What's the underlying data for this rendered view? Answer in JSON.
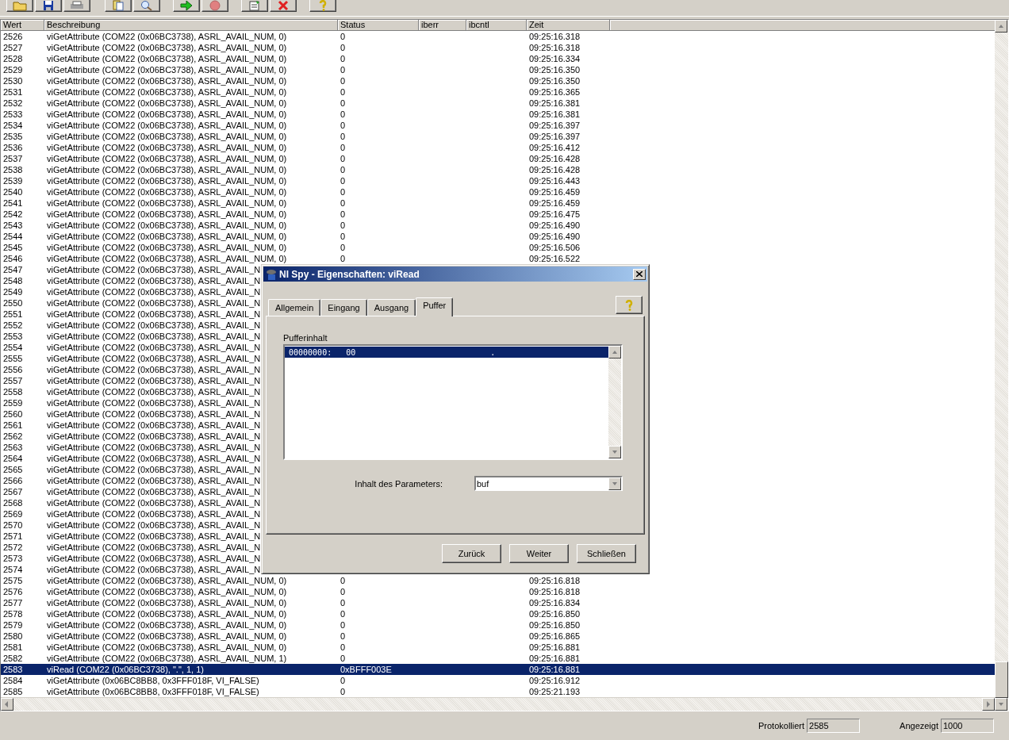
{
  "toolbar": {
    "buttons": [
      {
        "kind": "open"
      },
      {
        "kind": "save"
      },
      {
        "kind": "print"
      },
      {
        "kind": "copy"
      },
      {
        "kind": "find"
      },
      {
        "kind": "start"
      },
      {
        "kind": "stop"
      },
      {
        "kind": "properties"
      },
      {
        "kind": "clear"
      },
      {
        "kind": "help"
      }
    ]
  },
  "table": {
    "columns": [
      "Wert",
      "Beschreibung",
      "Status",
      "iberr",
      "ibcntl",
      "Zeit"
    ],
    "rows": [
      {
        "wert": "2526",
        "beschreibung": "viGetAttribute (COM22 (0x06BC3738), ASRL_AVAIL_NUM, 0)",
        "status": "0",
        "zeit": "09:25:16.318",
        "selected": false
      },
      {
        "wert": "2527",
        "beschreibung": "viGetAttribute (COM22 (0x06BC3738), ASRL_AVAIL_NUM, 0)",
        "status": "0",
        "zeit": "09:25:16.318",
        "selected": false
      },
      {
        "wert": "2528",
        "beschreibung": "viGetAttribute (COM22 (0x06BC3738), ASRL_AVAIL_NUM, 0)",
        "status": "0",
        "zeit": "09:25:16.334",
        "selected": false
      },
      {
        "wert": "2529",
        "beschreibung": "viGetAttribute (COM22 (0x06BC3738), ASRL_AVAIL_NUM, 0)",
        "status": "0",
        "zeit": "09:25:16.350",
        "selected": false
      },
      {
        "wert": "2530",
        "beschreibung": "viGetAttribute (COM22 (0x06BC3738), ASRL_AVAIL_NUM, 0)",
        "status": "0",
        "zeit": "09:25:16.350",
        "selected": false
      },
      {
        "wert": "2531",
        "beschreibung": "viGetAttribute (COM22 (0x06BC3738), ASRL_AVAIL_NUM, 0)",
        "status": "0",
        "zeit": "09:25:16.365",
        "selected": false
      },
      {
        "wert": "2532",
        "beschreibung": "viGetAttribute (COM22 (0x06BC3738), ASRL_AVAIL_NUM, 0)",
        "status": "0",
        "zeit": "09:25:16.381",
        "selected": false
      },
      {
        "wert": "2533",
        "beschreibung": "viGetAttribute (COM22 (0x06BC3738), ASRL_AVAIL_NUM, 0)",
        "status": "0",
        "zeit": "09:25:16.381",
        "selected": false
      },
      {
        "wert": "2534",
        "beschreibung": "viGetAttribute (COM22 (0x06BC3738), ASRL_AVAIL_NUM, 0)",
        "status": "0",
        "zeit": "09:25:16.397",
        "selected": false
      },
      {
        "wert": "2535",
        "beschreibung": "viGetAttribute (COM22 (0x06BC3738), ASRL_AVAIL_NUM, 0)",
        "status": "0",
        "zeit": "09:25:16.397",
        "selected": false
      },
      {
        "wert": "2536",
        "beschreibung": "viGetAttribute (COM22 (0x06BC3738), ASRL_AVAIL_NUM, 0)",
        "status": "0",
        "zeit": "09:25:16.412",
        "selected": false
      },
      {
        "wert": "2537",
        "beschreibung": "viGetAttribute (COM22 (0x06BC3738), ASRL_AVAIL_NUM, 0)",
        "status": "0",
        "zeit": "09:25:16.428",
        "selected": false
      },
      {
        "wert": "2538",
        "beschreibung": "viGetAttribute (COM22 (0x06BC3738), ASRL_AVAIL_NUM, 0)",
        "status": "0",
        "zeit": "09:25:16.428",
        "selected": false
      },
      {
        "wert": "2539",
        "beschreibung": "viGetAttribute (COM22 (0x06BC3738), ASRL_AVAIL_NUM, 0)",
        "status": "0",
        "zeit": "09:25:16.443",
        "selected": false
      },
      {
        "wert": "2540",
        "beschreibung": "viGetAttribute (COM22 (0x06BC3738), ASRL_AVAIL_NUM, 0)",
        "status": "0",
        "zeit": "09:25:16.459",
        "selected": false
      },
      {
        "wert": "2541",
        "beschreibung": "viGetAttribute (COM22 (0x06BC3738), ASRL_AVAIL_NUM, 0)",
        "status": "0",
        "zeit": "09:25:16.459",
        "selected": false
      },
      {
        "wert": "2542",
        "beschreibung": "viGetAttribute (COM22 (0x06BC3738), ASRL_AVAIL_NUM, 0)",
        "status": "0",
        "zeit": "09:25:16.475",
        "selected": false
      },
      {
        "wert": "2543",
        "beschreibung": "viGetAttribute (COM22 (0x06BC3738), ASRL_AVAIL_NUM, 0)",
        "status": "0",
        "zeit": "09:25:16.490",
        "selected": false
      },
      {
        "wert": "2544",
        "beschreibung": "viGetAttribute (COM22 (0x06BC3738), ASRL_AVAIL_NUM, 0)",
        "status": "0",
        "zeit": "09:25:16.490",
        "selected": false
      },
      {
        "wert": "2545",
        "beschreibung": "viGetAttribute (COM22 (0x06BC3738), ASRL_AVAIL_NUM, 0)",
        "status": "0",
        "zeit": "09:25:16.506",
        "selected": false
      },
      {
        "wert": "2546",
        "beschreibung": "viGetAttribute (COM22 (0x06BC3738), ASRL_AVAIL_NUM, 0)",
        "status": "0",
        "zeit": "09:25:16.522",
        "selected": false
      },
      {
        "wert": "2547",
        "beschreibung": "viGetAttribute (COM22 (0x06BC3738), ASRL_AVAIL_N",
        "selected": false
      },
      {
        "wert": "2548",
        "beschreibung": "viGetAttribute (COM22 (0x06BC3738), ASRL_AVAIL_N",
        "selected": false
      },
      {
        "wert": "2549",
        "beschreibung": "viGetAttribute (COM22 (0x06BC3738), ASRL_AVAIL_N",
        "selected": false
      },
      {
        "wert": "2550",
        "beschreibung": "viGetAttribute (COM22 (0x06BC3738), ASRL_AVAIL_N",
        "selected": false
      },
      {
        "wert": "2551",
        "beschreibung": "viGetAttribute (COM22 (0x06BC3738), ASRL_AVAIL_N",
        "selected": false
      },
      {
        "wert": "2552",
        "beschreibung": "viGetAttribute (COM22 (0x06BC3738), ASRL_AVAIL_N",
        "selected": false
      },
      {
        "wert": "2553",
        "beschreibung": "viGetAttribute (COM22 (0x06BC3738), ASRL_AVAIL_N",
        "selected": false
      },
      {
        "wert": "2554",
        "beschreibung": "viGetAttribute (COM22 (0x06BC3738), ASRL_AVAIL_N",
        "selected": false
      },
      {
        "wert": "2555",
        "beschreibung": "viGetAttribute (COM22 (0x06BC3738), ASRL_AVAIL_N",
        "selected": false
      },
      {
        "wert": "2556",
        "beschreibung": "viGetAttribute (COM22 (0x06BC3738), ASRL_AVAIL_N",
        "selected": false
      },
      {
        "wert": "2557",
        "beschreibung": "viGetAttribute (COM22 (0x06BC3738), ASRL_AVAIL_N",
        "selected": false
      },
      {
        "wert": "2558",
        "beschreibung": "viGetAttribute (COM22 (0x06BC3738), ASRL_AVAIL_N",
        "selected": false
      },
      {
        "wert": "2559",
        "beschreibung": "viGetAttribute (COM22 (0x06BC3738), ASRL_AVAIL_N",
        "selected": false
      },
      {
        "wert": "2560",
        "beschreibung": "viGetAttribute (COM22 (0x06BC3738), ASRL_AVAIL_N",
        "selected": false
      },
      {
        "wert": "2561",
        "beschreibung": "viGetAttribute (COM22 (0x06BC3738), ASRL_AVAIL_N",
        "selected": false
      },
      {
        "wert": "2562",
        "beschreibung": "viGetAttribute (COM22 (0x06BC3738), ASRL_AVAIL_N",
        "selected": false
      },
      {
        "wert": "2563",
        "beschreibung": "viGetAttribute (COM22 (0x06BC3738), ASRL_AVAIL_N",
        "selected": false
      },
      {
        "wert": "2564",
        "beschreibung": "viGetAttribute (COM22 (0x06BC3738), ASRL_AVAIL_N",
        "selected": false
      },
      {
        "wert": "2565",
        "beschreibung": "viGetAttribute (COM22 (0x06BC3738), ASRL_AVAIL_N",
        "selected": false
      },
      {
        "wert": "2566",
        "beschreibung": "viGetAttribute (COM22 (0x06BC3738), ASRL_AVAIL_N",
        "selected": false
      },
      {
        "wert": "2567",
        "beschreibung": "viGetAttribute (COM22 (0x06BC3738), ASRL_AVAIL_N",
        "selected": false
      },
      {
        "wert": "2568",
        "beschreibung": "viGetAttribute (COM22 (0x06BC3738), ASRL_AVAIL_N",
        "selected": false
      },
      {
        "wert": "2569",
        "beschreibung": "viGetAttribute (COM22 (0x06BC3738), ASRL_AVAIL_N",
        "selected": false
      },
      {
        "wert": "2570",
        "beschreibung": "viGetAttribute (COM22 (0x06BC3738), ASRL_AVAIL_N",
        "selected": false
      },
      {
        "wert": "2571",
        "beschreibung": "viGetAttribute (COM22 (0x06BC3738), ASRL_AVAIL_N",
        "selected": false
      },
      {
        "wert": "2572",
        "beschreibung": "viGetAttribute (COM22 (0x06BC3738), ASRL_AVAIL_N",
        "selected": false
      },
      {
        "wert": "2573",
        "beschreibung": "viGetAttribute (COM22 (0x06BC3738), ASRL_AVAIL_N",
        "selected": false
      },
      {
        "wert": "2574",
        "beschreibung": "viGetAttribute (COM22 (0x06BC3738), ASRL_AVAIL_N",
        "selected": false
      },
      {
        "wert": "2575",
        "beschreibung": "viGetAttribute (COM22 (0x06BC3738), ASRL_AVAIL_NUM, 0)",
        "status": "0",
        "zeit": "09:25:16.818",
        "selected": false
      },
      {
        "wert": "2576",
        "beschreibung": "viGetAttribute (COM22 (0x06BC3738), ASRL_AVAIL_NUM, 0)",
        "status": "0",
        "zeit": "09:25:16.818",
        "selected": false
      },
      {
        "wert": "2577",
        "beschreibung": "viGetAttribute (COM22 (0x06BC3738), ASRL_AVAIL_NUM, 0)",
        "status": "0",
        "zeit": "09:25:16.834",
        "selected": false
      },
      {
        "wert": "2578",
        "beschreibung": "viGetAttribute (COM22 (0x06BC3738), ASRL_AVAIL_NUM, 0)",
        "status": "0",
        "zeit": "09:25:16.850",
        "selected": false
      },
      {
        "wert": "2579",
        "beschreibung": "viGetAttribute (COM22 (0x06BC3738), ASRL_AVAIL_NUM, 0)",
        "status": "0",
        "zeit": "09:25:16.850",
        "selected": false
      },
      {
        "wert": "2580",
        "beschreibung": "viGetAttribute (COM22 (0x06BC3738), ASRL_AVAIL_NUM, 0)",
        "status": "0",
        "zeit": "09:25:16.865",
        "selected": false
      },
      {
        "wert": "2581",
        "beschreibung": "viGetAttribute (COM22 (0x06BC3738), ASRL_AVAIL_NUM, 0)",
        "status": "0",
        "zeit": "09:25:16.881",
        "selected": false
      },
      {
        "wert": "2582",
        "beschreibung": "viGetAttribute (COM22 (0x06BC3738), ASRL_AVAIL_NUM, 1)",
        "status": "0",
        "zeit": "09:25:16.881",
        "selected": false
      },
      {
        "wert": "2583",
        "beschreibung": "viRead (COM22 (0x06BC3738), \".\", 1, 1)",
        "status": "0xBFFF003E",
        "zeit": "09:25:16.881",
        "selected": true
      },
      {
        "wert": "2584",
        "beschreibung": "viGetAttribute (0x06BC8BB8, 0x3FFF018F, VI_FALSE)",
        "status": "0",
        "zeit": "09:25:16.912",
        "selected": false
      },
      {
        "wert": "2585",
        "beschreibung": "viGetAttribute (0x06BC8BB8, 0x3FFF018F, VI_FALSE)",
        "status": "0",
        "zeit": "09:25:21.193",
        "selected": false
      }
    ]
  },
  "status_bar": [
    {
      "label": "Protokolliert",
      "value": "2585"
    },
    {
      "label": "Angezeigt",
      "value": "1000"
    }
  ],
  "dialog": {
    "title": "NI Spy - Eigenschaften: viRead",
    "tabs": [
      {
        "label": "Allgemein",
        "selected": false
      },
      {
        "label": "Eingang",
        "selected": false
      },
      {
        "label": "Ausgang",
        "selected": false
      },
      {
        "label": "Puffer",
        "selected": true
      }
    ],
    "buffer_label": "Pufferinhalt",
    "buffer_lines": [
      {
        "offset": "00000000:",
        "hex": "00",
        "ascii": ".",
        "selected": true
      }
    ],
    "parameter_label": "Inhalt des Parameters:",
    "parameter_value": "buf",
    "buttons": [
      "Zurück",
      "Weiter",
      "Schließen"
    ]
  }
}
